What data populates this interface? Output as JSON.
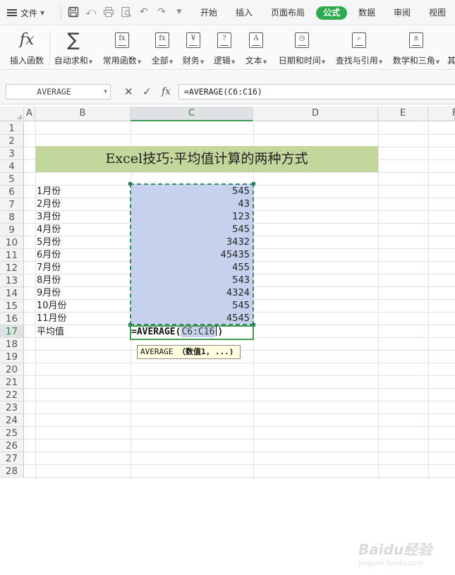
{
  "menubar": {
    "file_label": "文件",
    "tabs": [
      "开始",
      "插入",
      "页面布局",
      "公式",
      "数据",
      "审阅",
      "视图"
    ],
    "active_tab": "公式"
  },
  "ribbon": {
    "insert_function": "插入函数",
    "autosum": "自动求和",
    "common_functions": "常用函数",
    "all": "全部",
    "financial": "财务",
    "logical": "逻辑",
    "text": "文本",
    "datetime": "日期和时间",
    "lookup": "查找与引用",
    "math": "数学和三角",
    "more": "其"
  },
  "formula_bar": {
    "name_box": "AVERAGE",
    "formula": "=AVERAGE(C6:C16)"
  },
  "sheet": {
    "columns": [
      "A",
      "B",
      "C",
      "D",
      "E",
      "F"
    ],
    "rows": [
      "1",
      "2",
      "3",
      "4",
      "5",
      "6",
      "7",
      "8",
      "9",
      "10",
      "11",
      "12",
      "13",
      "14",
      "15",
      "16",
      "17",
      "18",
      "19",
      "20",
      "21",
      "22",
      "23",
      "24",
      "25",
      "26",
      "27",
      "28"
    ],
    "title": "Excel技巧:平均值计算的两种方式",
    "months": [
      "1月份",
      "2月份",
      "3月份",
      "4月份",
      "5月份",
      "6月份",
      "7月份",
      "8月份",
      "9月份",
      "10月份",
      "11月份"
    ],
    "values": [
      "545",
      "43",
      "123",
      "545",
      "3432",
      "45435",
      "455",
      "543",
      "4324",
      "545",
      "4545"
    ],
    "avg_label": "平均值",
    "editing": {
      "prefix": "=AVERAGE(",
      "ref": "C6:C16",
      "suffix": ")"
    },
    "tooltip": {
      "func": "AVERAGE",
      "args": "（数值1, ...)"
    }
  },
  "watermark": {
    "brand": "Baidu经验",
    "url": "jingyan.baidu.com"
  },
  "colors": {
    "accent": "#2faa4f",
    "title_fill": "#c3d69b",
    "selection_fill": "#c6d2ed"
  }
}
